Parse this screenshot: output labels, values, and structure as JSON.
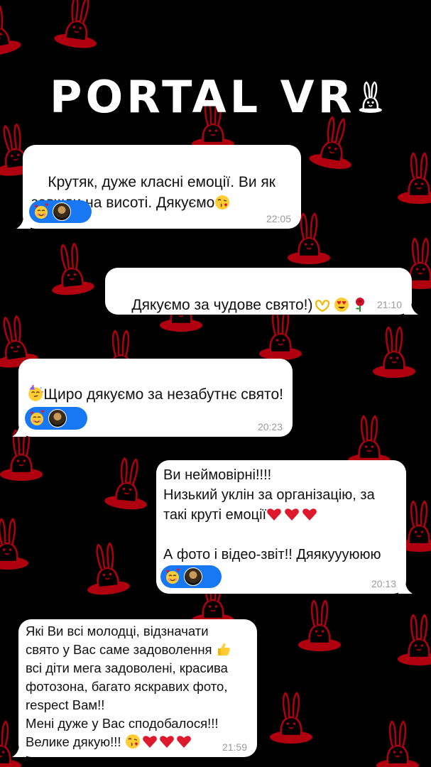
{
  "brand": {
    "logo_text": "PORTAL VR",
    "logo_icon": "bunny-icon"
  },
  "colors": {
    "background": "#000000",
    "pattern": "#b00010",
    "bubble": "#ffffff",
    "reaction_pill": "#1877f2",
    "heart": "#e0182d"
  },
  "messages": [
    {
      "side": "left",
      "text": "Крутяк, дуже класні емоції. Ви як завжди на висоті. Дякуємо",
      "trailing_emojis": [
        "kissing-face-icon"
      ],
      "time": "22:05",
      "reactions": [
        "smiling-face-with-hearts-icon",
        "user-avatar"
      ]
    },
    {
      "side": "right",
      "text": "Дякуємо за чудове свято!)",
      "trailing_emojis": [
        "heart-hands-icon",
        "heart-eyes-icon",
        "rose-icon"
      ],
      "time": "21:10",
      "reactions": []
    },
    {
      "side": "left",
      "text": "Щиро дякуємо за незабутнє свято!",
      "trailing_emojis": [
        "partying-face-icon"
      ],
      "time": "20:23",
      "reactions": [
        "smiling-face-with-hearts-icon",
        "user-avatar"
      ]
    },
    {
      "side": "right",
      "lines": [
        "Ви неймовірні!!!!",
        "Низький уклін за організацію, за",
        "такі круті емоції",
        "",
        "А фото і відео-звіт!! Дяякуууююю"
      ],
      "line3_emojis": [
        "red-heart-icon",
        "red-heart-icon",
        "red-heart-icon"
      ],
      "time": "20:13",
      "reactions": [
        "smiling-face-with-hearts-icon",
        "user-avatar"
      ]
    },
    {
      "side": "left",
      "lines": [
        "Які Ви всі молодці, відзначати",
        "свято у Вас саме задоволення",
        "всі діти мега задоволені, красива",
        "фотозона, багато яскравих фото,",
        "respect Вам!!",
        "Мені дуже у Вас сподобалося!!!",
        "Велике дякую!!!"
      ],
      "line2_emojis": [
        "thumbs-up-icon"
      ],
      "line7_emojis": [
        "kissing-face-icon",
        "red-heart-icon",
        "red-heart-icon",
        "red-heart-icon"
      ],
      "time": "21:59",
      "reactions": []
    }
  ]
}
